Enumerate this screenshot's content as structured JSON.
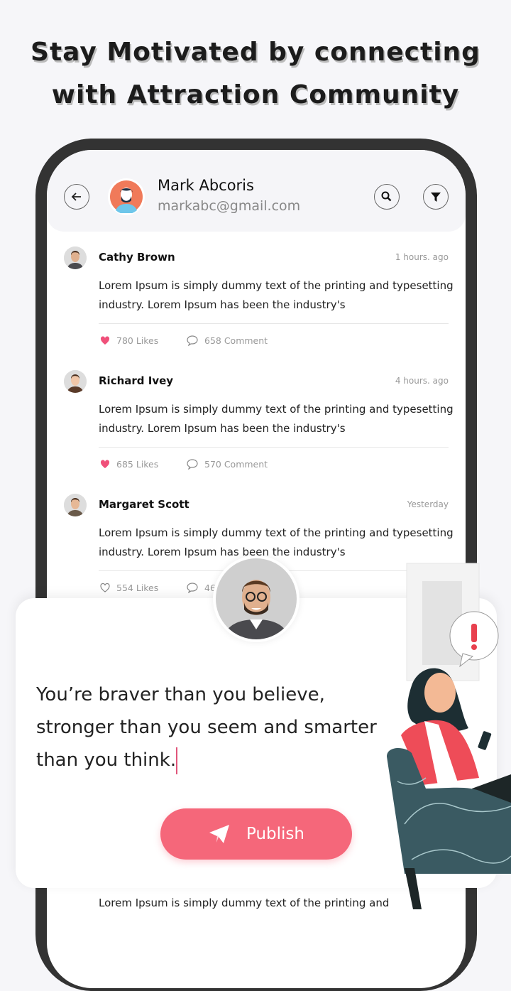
{
  "headline": {
    "line1": "Stay Motivated by connecting",
    "line2": "with Attraction Community"
  },
  "header": {
    "name": "Mark Abcoris",
    "email": "markabc@gmail.com",
    "back_icon": "arrow-left-icon",
    "search_icon": "search-icon",
    "filter_icon": "filter-icon"
  },
  "posts": [
    {
      "name": "Cathy Brown",
      "time": "1 hours. ago",
      "text": "Lorem Ipsum is simply dummy text of the printing and typesetting industry. Lorem Ipsum has been the industry's",
      "likes": "780 Likes",
      "comments": "658 Comment",
      "liked": true
    },
    {
      "name": "Richard Ivey",
      "time": "4 hours. ago",
      "text": "Lorem Ipsum is simply dummy text of the printing and typesetting industry. Lorem Ipsum has been the industry's",
      "likes": "685 Likes",
      "comments": "570 Comment",
      "liked": true
    },
    {
      "name": "Margaret Scott",
      "time": "Yesterday",
      "text": "Lorem Ipsum is simply dummy text of the printing and typesetting industry. Lorem Ipsum has been the industry's",
      "likes": "554 Likes",
      "comments": "46",
      "liked": false
    }
  ],
  "composer": {
    "text": "You’re braver than you believe, stronger than you seem and smarter than you think.",
    "publish_label": "Publish"
  },
  "bottom_peek": "Lorem Ipsum is simply dummy text of the printing and",
  "colors": {
    "accent": "#f5677a",
    "heart": "#f0507a",
    "frame": "#333333"
  }
}
